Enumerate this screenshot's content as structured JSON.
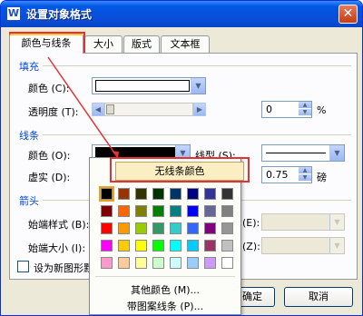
{
  "window": {
    "title": "设置对象格式",
    "app_icon_glyph": "W",
    "close_glyph": "✕"
  },
  "tabs": [
    {
      "label": "颜色与线条",
      "active": true
    },
    {
      "label": "大小",
      "active": false
    },
    {
      "label": "版式",
      "active": false
    },
    {
      "label": "文本框",
      "active": false
    }
  ],
  "fill": {
    "section": "填充",
    "color_label": "颜色 (C):",
    "transparency_label": "透明度 (T):",
    "transparency_value": "0",
    "transparency_unit": "%",
    "transparency_level": 0
  },
  "line": {
    "section": "线条",
    "color_label": "颜色 (O):",
    "style_label": "线型 (S):",
    "dash_label": "虚实 (D):",
    "weight_value": "0.75",
    "weight_unit": "磅"
  },
  "arrows": {
    "section": "箭头",
    "begin_style_label": "始端样式 (B):",
    "begin_size_label": "始端大小 (I):",
    "end_style_suffix": "(E):",
    "end_size_suffix": "(Z):"
  },
  "default_checkbox": {
    "label": "设为新图形默",
    "checked": false
  },
  "buttons": {
    "ok": "确定",
    "cancel": "取消"
  },
  "color_popup": {
    "no_line_label": "无线条颜色",
    "more_colors_label": "其他颜色 (M)...",
    "pattern_line_label": "带图案线条 (P)...",
    "palette": [
      [
        "#000000",
        "#993300",
        "#333300",
        "#003300",
        "#003366",
        "#000080",
        "#333399",
        "#333333"
      ],
      [
        "#800000",
        "#ff6600",
        "#808000",
        "#008000",
        "#008080",
        "#0000ff",
        "#666699",
        "#808080"
      ],
      [
        "#ff0000",
        "#ff9900",
        "#99cc00",
        "#339966",
        "#33cccc",
        "#3366ff",
        "#800080",
        "#969696"
      ],
      [
        "#ff00ff",
        "#ffcc00",
        "#ffff00",
        "#00ff00",
        "#00ffff",
        "#00ccff",
        "#993366",
        "#c0c0c0"
      ],
      [
        "#ff99cc",
        "#ffcc99",
        "#ffff99",
        "#ccffcc",
        "#ccffff",
        "#99ccff",
        "#cc99ff",
        "#ffffff"
      ]
    ],
    "selected_color": "#000000"
  },
  "highlight_color": "#e33232"
}
